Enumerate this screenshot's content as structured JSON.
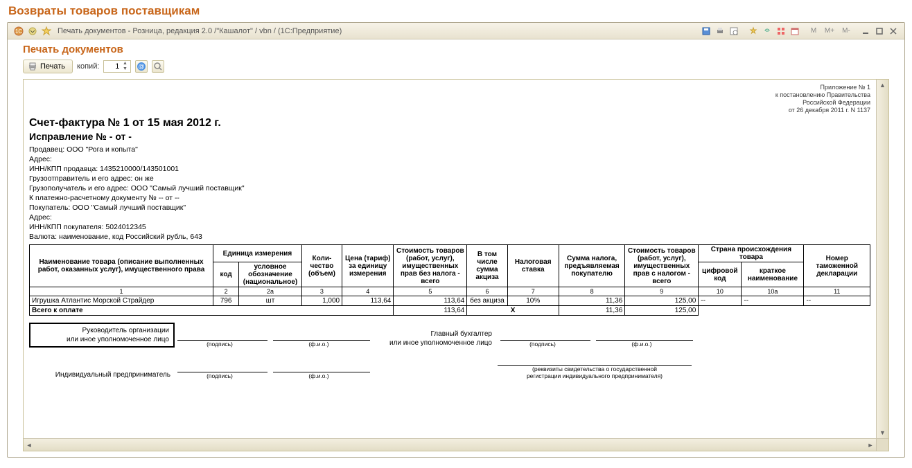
{
  "pageTitle": "Возвраты товаров поставщикам",
  "windowTitle": "Печать документов - Розница, редакция 2.0 /\"Кашалот\" / vbn /  (1С:Предприятие)",
  "sectionTitle": "Печать документов",
  "toolbar": {
    "print": "Печать",
    "copiesLabel": "копий:",
    "copiesValue": "1"
  },
  "sysButtons": {
    "m": "M",
    "mPlus": "M+",
    "mMinus": "M-"
  },
  "annex": {
    "l1": "Приложение № 1",
    "l2": "к постановлению Правительства",
    "l3": "Российской Федерации",
    "l4": "от 26 декабря 2011 г. N 1137"
  },
  "doc": {
    "title": "Счет-фактура № 1 от 15 мая 2012 г.",
    "subtitle": "Исправление № - от -",
    "lines": [
      "Продавец: ООО \"Рога и копыта\"",
      "Адрес:",
      "ИНН/КПП продавца: 1435210000/143501001",
      "Грузоотправитель и его адрес: он же",
      "Грузополучатель и его адрес: ООО \"Самый лучший поставщик\"",
      "К платежно-расчетному документу № -- от --",
      "Покупатель: ООО \"Самый лучший поставщик\"",
      "Адрес:",
      "ИНН/КПП покупателя: 5024012345",
      "Валюта: наименование, код Российский рубль, 643"
    ]
  },
  "table": {
    "headers": {
      "name": "Наименование товара (описание выполненных работ, оказанных услуг), имущественного права",
      "unit": "Единица измерения",
      "unitCode": "код",
      "unitCond": "условное обозначение (национальное)",
      "qty": "Коли-чество (объем)",
      "price": "Цена (тариф) за единицу измерения",
      "costNoTax": "Стоимость товаров (работ, услуг), имущественных прав без налога - всего",
      "excise": "В том числе сумма акциза",
      "taxRate": "Налоговая ставка",
      "taxSum": "Сумма налога, предъявляемая покупателю",
      "costWithTax": "Стоимость товаров (работ, услуг), имущественных прав с налогом - всего",
      "country": "Страна происхождения товара",
      "countryCode": "цифровой код",
      "countryName": "краткое наименование",
      "declNum": "Номер таможенной декларации"
    },
    "nums": [
      "1",
      "2",
      "2а",
      "3",
      "4",
      "5",
      "6",
      "7",
      "8",
      "9",
      "10",
      "10а",
      "11"
    ],
    "row": {
      "name": "Игрушка Атлантис Морской Страйдер",
      "code": "796",
      "unit": "шт",
      "qty": "1,000",
      "price": "113,64",
      "costNoTax": "113,64",
      "excise": "без акциза",
      "taxRate": "10%",
      "taxSum": "11,36",
      "costWithTax": "125,00",
      "cc": "--",
      "cn": "--",
      "dn": "--"
    },
    "total": {
      "label": "Всего к оплате",
      "costNoTax": "113,64",
      "x": "X",
      "taxSum": "11,36",
      "costWithTax": "125,00"
    }
  },
  "sign": {
    "head1": "Руководитель организации",
    "head2": "или иное уполномоченное лицо",
    "acc1": "Главный бухгалтер",
    "acc2": "или иное уполномоченное лицо",
    "ip": "Индивидуальный предприниматель",
    "sig": "(подпись)",
    "fio": "(ф.и.о.)",
    "req1": "(реквизиты свидетельства о государственной",
    "req2": "регистрации индивидуального предпринимателя)"
  }
}
